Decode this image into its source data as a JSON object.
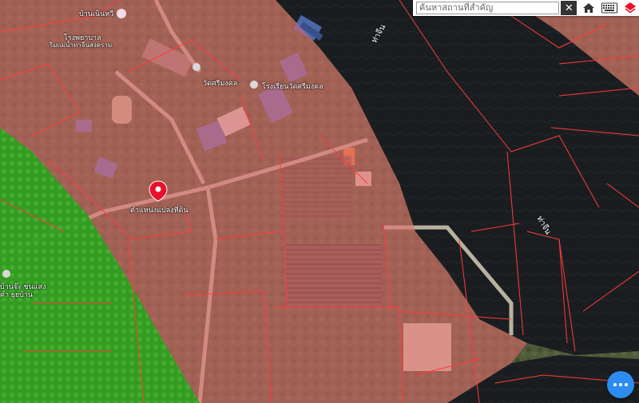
{
  "search": {
    "placeholder": "ค้นหาสถานที่สำคัญ"
  },
  "toolbar": {
    "clear_icon": "close-icon",
    "home_icon": "home-icon",
    "keyboard_icon": "keyboard-icon",
    "layers_icon": "layers-icon"
  },
  "map": {
    "pin_label": "ตำแหน่งแปลงที่ดิน",
    "labels": {
      "school": "โรงเรียนวัดศรีมงคล",
      "temple": "วัดศรีมงคล",
      "village": "บ้านเนินหวี",
      "river_1": "ท่าจีน",
      "river_2": "ท่าจีน",
      "office": "โรงพยาบาล",
      "office_sub": "ริมแม่น้ำท่าจีนสงคราม",
      "left_1": "บ้านจ๊ะ ชนแสง",
      "left_2": "คำ ยุยบ้าน"
    }
  },
  "colors": {
    "overlay": "#e8676b",
    "parcel_line": "#ff3b3b",
    "river": "#15171a",
    "green_zone": "#2fa320",
    "pin": "#e8102a",
    "fab": "#2d8cf0"
  },
  "fab": {
    "icon": "more-dots-icon"
  }
}
